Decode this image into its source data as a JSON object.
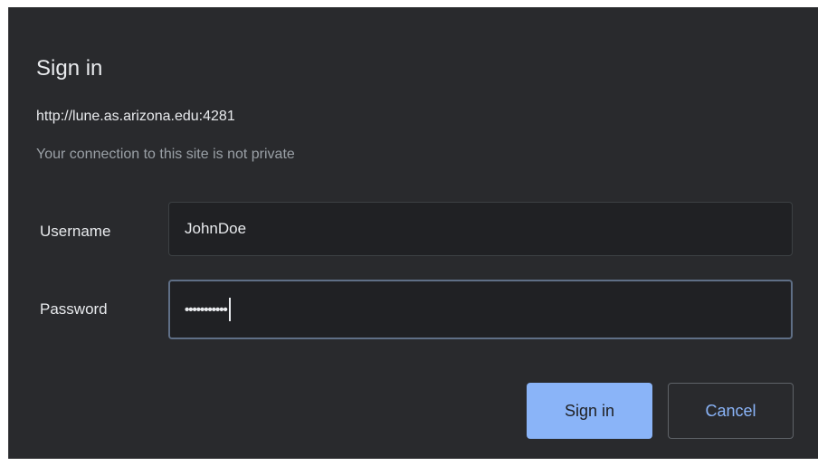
{
  "dialog": {
    "title": "Sign in",
    "url": "http://lune.as.arizona.edu:4281",
    "warning": "Your connection to this site is not private"
  },
  "form": {
    "username_label": "Username",
    "username_value": "JohnDoe",
    "password_label": "Password",
    "password_masked": "•••••••••••"
  },
  "buttons": {
    "signin_label": "Sign in",
    "cancel_label": "Cancel"
  },
  "colors": {
    "background": "#292a2d",
    "accent": "#8ab4f8",
    "text": "#e8eaed",
    "muted_text": "#9aa0a6"
  }
}
